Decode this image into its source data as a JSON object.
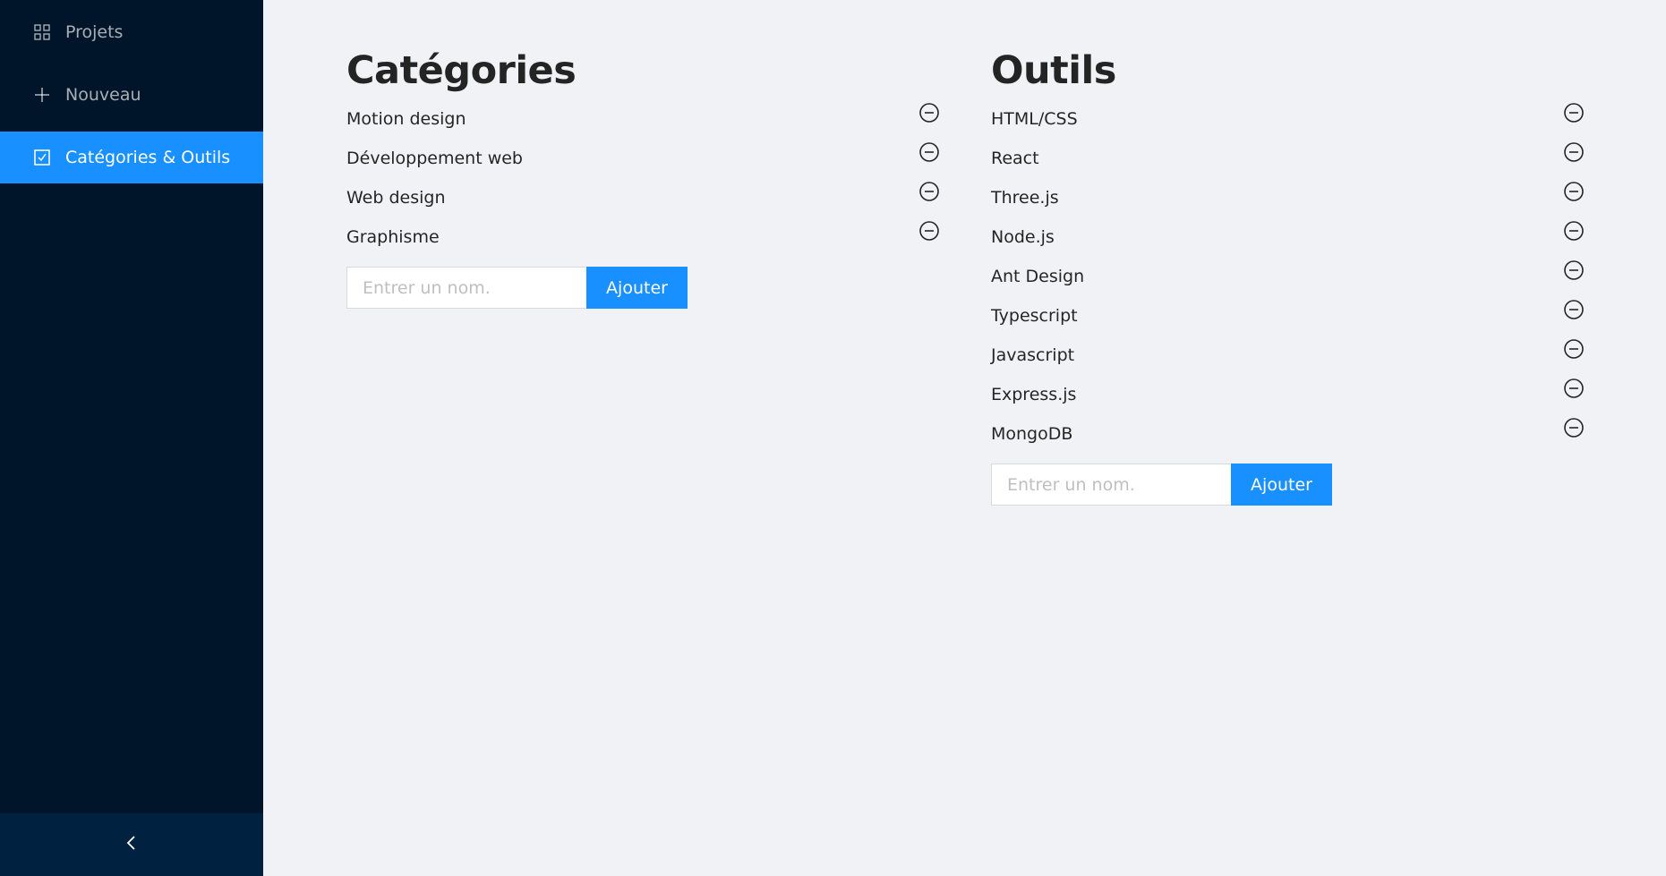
{
  "sidebar": {
    "items": [
      {
        "label": "Projets",
        "icon": "appstore-icon"
      },
      {
        "label": "Nouveau",
        "icon": "plus-icon"
      },
      {
        "label": "Catégories & Outils",
        "icon": "checkbox-icon",
        "selected": true
      }
    ],
    "collapse_icon": "chevron-left-icon"
  },
  "categories": {
    "title": "Catégories",
    "items": [
      "Motion design",
      "Développement web",
      "Web design",
      "Graphisme"
    ],
    "input_placeholder": "Entrer un nom.",
    "add_label": "Ajouter"
  },
  "tools": {
    "title": "Outils",
    "items": [
      "HTML/CSS",
      "React",
      "Three.js",
      "Node.js",
      "Ant Design",
      "Typescript",
      "Javascript",
      "Express.js",
      "MongoDB"
    ],
    "input_placeholder": "Entrer un nom.",
    "add_label": "Ajouter"
  },
  "colors": {
    "sidebar_bg": "#001529",
    "accent": "#1890ff",
    "content_bg": "#f0f2f5"
  }
}
